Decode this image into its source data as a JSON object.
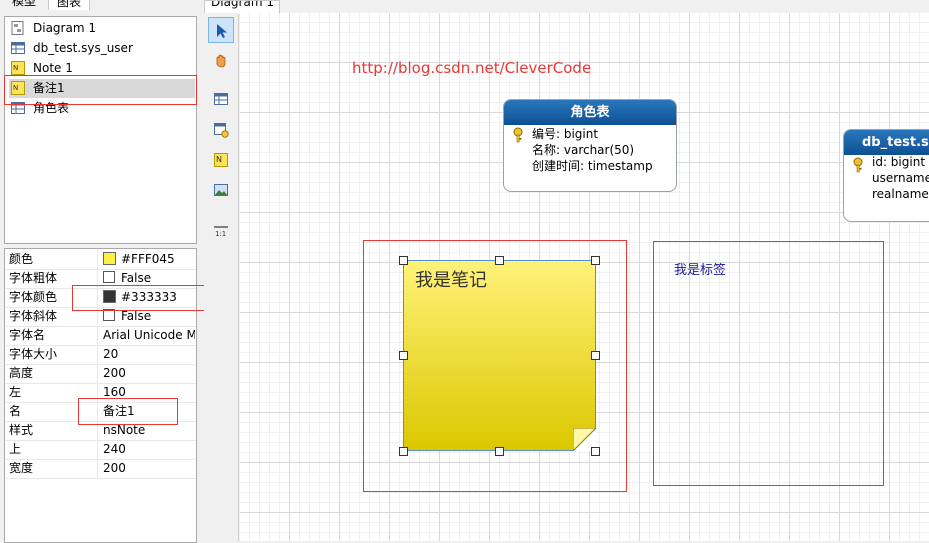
{
  "left_tabs": [
    "模型",
    "图表"
  ],
  "tree": {
    "items": [
      {
        "label": "Diagram 1",
        "icon": "diagram-icon"
      },
      {
        "label": "db_test.sys_user",
        "icon": "table-icon"
      },
      {
        "label": "Note 1",
        "icon": "note-icon"
      },
      {
        "label": "备注1",
        "icon": "note-icon"
      },
      {
        "label": "角色表",
        "icon": "table-icon"
      }
    ]
  },
  "properties": [
    {
      "name": "颜色",
      "value": "#FFF045",
      "kind": "color",
      "swatch": "#FFF045"
    },
    {
      "name": "字体粗体",
      "value": "False",
      "kind": "bool"
    },
    {
      "name": "字体颜色",
      "value": "#333333",
      "kind": "color",
      "swatch": "#333333"
    },
    {
      "name": "字体斜体",
      "value": "False",
      "kind": "bool"
    },
    {
      "name": "字体名",
      "value": "Arial Unicode MS",
      "kind": "text"
    },
    {
      "name": "字体大小",
      "value": "20",
      "kind": "text"
    },
    {
      "name": "高度",
      "value": "200",
      "kind": "text"
    },
    {
      "name": "左",
      "value": "160",
      "kind": "text"
    },
    {
      "name": "名",
      "value": "备注1",
      "kind": "text"
    },
    {
      "name": "样式",
      "value": "nsNote",
      "kind": "text"
    },
    {
      "name": "上",
      "value": "240",
      "kind": "text"
    },
    {
      "name": "宽度",
      "value": "200",
      "kind": "text"
    }
  ],
  "tools": [
    "pointer-icon",
    "hand-icon",
    "table-tool-icon",
    "view-tool-icon",
    "note-tool-icon",
    "image-tool-icon",
    "zoom-reset-icon"
  ],
  "tools_zoom_label": "1:1",
  "document_tab": "Diagram 1",
  "canvas": {
    "url_text": "http://blog.csdn.net/CleverCode",
    "entities": [
      {
        "title": "角色表",
        "fields": [
          "编号: bigint",
          "名称: varchar(50)",
          "创建时间: timestamp"
        ]
      },
      {
        "title": "db_test.s",
        "fields": [
          "id: bigint",
          "username",
          "realname:"
        ]
      }
    ],
    "note_text": "我是笔记",
    "label_text": "我是标签"
  },
  "colors": {
    "accent_red": "#e53935",
    "entity_header": "#0d5092",
    "note_top": "#fff27a",
    "note_bottom": "#dcc700"
  }
}
